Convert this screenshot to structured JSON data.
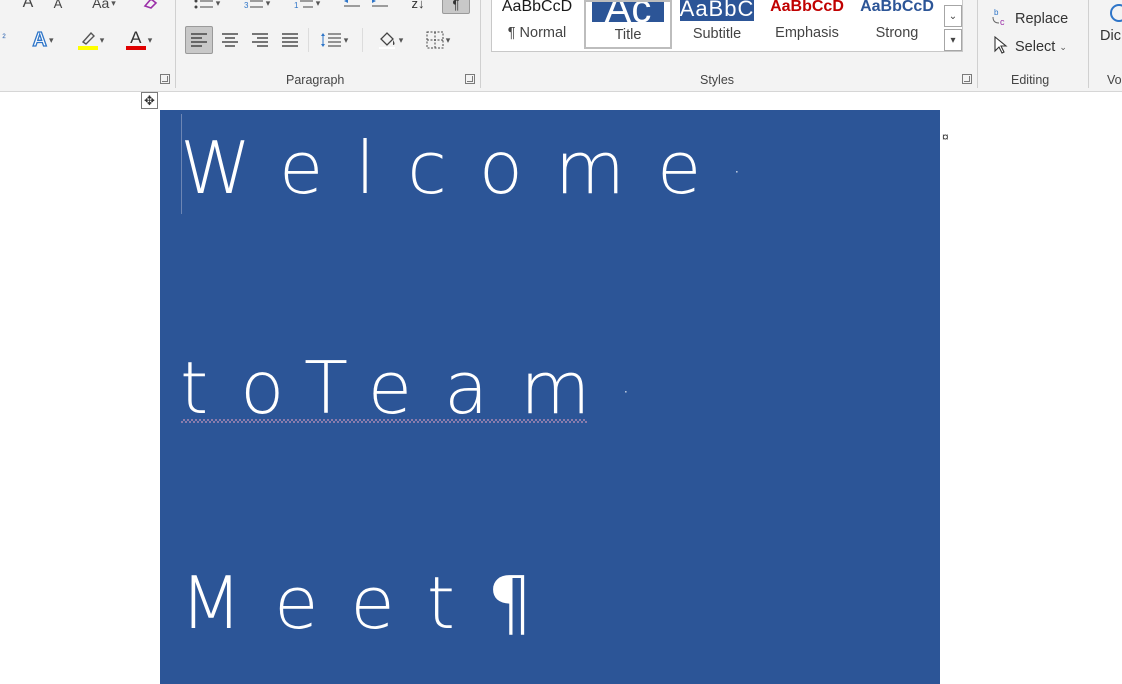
{
  "ribbon": {
    "font": {
      "change_case_label": "Aa",
      "text_effects_label": "A",
      "font_color_label": "A",
      "highlight_color": "#ffff00",
      "font_color": "#e00000"
    },
    "paragraph": {
      "group_label": "Paragraph"
    },
    "styles": {
      "group_label": "Styles",
      "items": [
        {
          "preview": "AaBbCcD",
          "name": "¶ Normal",
          "preview_color": "#1a1a1a"
        },
        {
          "preview": "Ac",
          "name": "Title",
          "preview_color": "#ffffff",
          "preview_bg": "#2c5597"
        },
        {
          "preview": "AaBbC",
          "name": "Subtitle",
          "preview_color": "#ffffff",
          "preview_bg": "#2c5597"
        },
        {
          "preview": "AaBbCcD",
          "name": "Emphasis",
          "preview_color": "#c00000"
        },
        {
          "preview": "AaBbCcD",
          "name": "Strong",
          "preview_color": "#2c5597"
        }
      ]
    },
    "editing": {
      "group_label": "Editing",
      "replace_label": "Replace",
      "select_label": "Select"
    },
    "voice": {
      "dictate_label": "Dic",
      "group_label": "Vo"
    }
  },
  "document": {
    "lines": [
      {
        "text": "Welcome",
        "mark": "·"
      },
      {
        "text": "toTeam",
        "mark": "·"
      },
      {
        "text": "Meet",
        "mark": "¶"
      }
    ],
    "end_of_cell_mark": "¤",
    "cell_background": "#2c5597"
  }
}
